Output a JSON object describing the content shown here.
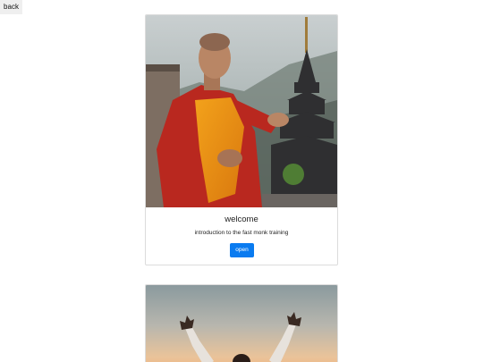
{
  "nav": {
    "back_label": "back"
  },
  "cards": [
    {
      "image": "monk-at-temple",
      "title": "welcome",
      "description": "introduction to the fast monk training",
      "button_label": "open"
    },
    {
      "image": "raised-arms-at-sunset"
    }
  ],
  "colors": {
    "primary_button": "#0a7bf0",
    "card_border": "#dcdcdc"
  }
}
